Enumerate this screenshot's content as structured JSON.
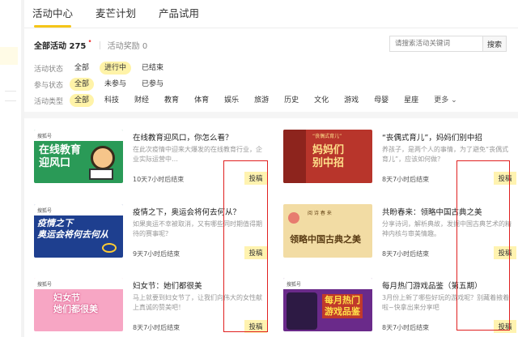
{
  "tabs": [
    {
      "label": "活动中心",
      "active": true
    },
    {
      "label": "麦芒计划",
      "active": false
    },
    {
      "label": "产品试用",
      "active": false
    }
  ],
  "counts": {
    "all_label": "全部活动 275",
    "dot": "•",
    "reward_label": "活动奖励 0"
  },
  "search": {
    "placeholder": "请搜索活动关键词",
    "button": "搜索"
  },
  "filters": [
    {
      "label": "活动状态",
      "options": [
        "全部",
        "进行中",
        "已结束"
      ],
      "selected": 1
    },
    {
      "label": "参与状态",
      "options": [
        "全部",
        "未参与",
        "已参与"
      ],
      "selected": 0
    },
    {
      "label": "活动类型",
      "options": [
        "全部",
        "科技",
        "财经",
        "教育",
        "体育",
        "娱乐",
        "旅游",
        "历史",
        "文化",
        "游戏",
        "母婴",
        "星座"
      ],
      "selected": 0,
      "more": "更多"
    }
  ],
  "submit_label": "投稿",
  "cards": [
    {
      "title": "在线教育迎风口，你怎么看？",
      "desc": "在此次疫情中迎来大爆发的在线教育行业，企业实际运营中…",
      "end": "10天7小时后结束",
      "art": "在线教育\n迎风口",
      "badge": "搜狐号"
    },
    {
      "title": "“丧偶式育儿”，妈妈们别中招",
      "desc": "养孩子，是两个人的事情，为了避免“丧偶式育儿”，应该如何做？",
      "end": "8天7小时后结束",
      "art": "妈妈们\n别中招",
      "badge": "“丧偶式育儿”"
    },
    {
      "title": "疫情之下，奥运会将何去何从？",
      "desc": "如果奥运不幸被取消，又有哪些同时期值得期待的赛事呢？",
      "end": "9天7小时后结束",
      "art": "疫情之下\n奥运会将何去何从",
      "badge": "搜狐号"
    },
    {
      "title": "共盼春来：领略中国古典之美",
      "desc": "分享诗词，解析典故，发掘中国古典艺术的精神内核与审美情趣。",
      "end": "8天7小时后结束",
      "art": "领略中国古典之美",
      "badge": "阅 诗 春 来"
    },
    {
      "title": "妇女节：她们都很美",
      "desc": "马上就要到妇女节了，让我们向伟大的女性献上真诚的赞美吧！",
      "end": "8天7小时后结束",
      "art": "妇女节\n她们都很美",
      "badge": "搜狐号"
    },
    {
      "title": "每月热门游戏品鉴（第五期）",
      "desc": "3月份上新了哪些好玩的游戏呢？别藏着掖着啦~快拿出来分享吧",
      "end": "8天7小时后结束",
      "art": "每月热门\n游戏品鉴",
      "badge": "搜狐号"
    }
  ],
  "colors": {
    "accent": "#f5c518",
    "chip_selected": "#fff3a8",
    "annotation": "#e02020"
  }
}
